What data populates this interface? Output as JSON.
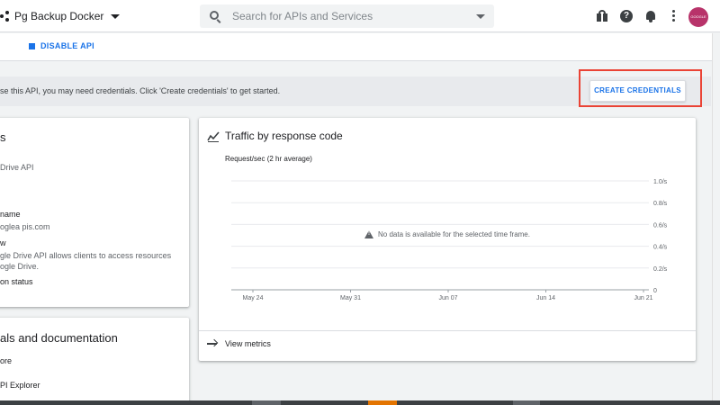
{
  "header": {
    "project_name": "Pg Backup Docker",
    "search_placeholder": "Search for APIs and Services",
    "help_glyph": "?",
    "avatar_text": "GOOGLE"
  },
  "toolbar": {
    "disable_api_label": "DISABLE API"
  },
  "banner": {
    "text": "se this API, you may need credentials. Click 'Create credentials' to get started.",
    "create_credentials_label": "CREATE CREDENTIALS"
  },
  "details_card": {
    "title": "s",
    "product_value": "Drive API",
    "service_name_label": "name",
    "service_name_value": "oglea pis.com",
    "overview_label": "w",
    "overview_line1": "gle Drive API allows clients to access resources",
    "overview_line2": "ogle Drive.",
    "activation_label": "on status"
  },
  "docs_card": {
    "title": "als and documentation",
    "link1": "ore",
    "link2": "PI Explorer"
  },
  "traffic_card": {
    "title": "Traffic by response code",
    "subtitle": "Request/sec (2 hr average)",
    "no_data_message": "No data is available for the selected time frame.",
    "view_metrics_label": "View metrics"
  },
  "chart_data": {
    "type": "line",
    "title": "Traffic by response code",
    "subtitle": "Request/sec (2 hr average)",
    "x_tick_labels": [
      "May 24",
      "May 31",
      "Jun 07",
      "Jun 14",
      "Jun 21"
    ],
    "y_tick_labels": [
      "1.0/s",
      "0.8/s",
      "0.6/s",
      "0.4/s",
      "0.2/s",
      "0"
    ],
    "y_tick_values": [
      1.0,
      0.8,
      0.6,
      0.4,
      0.2,
      0
    ],
    "ylim": [
      0,
      1.0
    ],
    "series": [],
    "grid": true
  },
  "colors": {
    "accent": "#1a73e8",
    "highlight": "#ea4335",
    "avatar": "#b8336a"
  },
  "taskbar_colors": [
    "#5f6368",
    "#e37400",
    "#5f6368"
  ]
}
